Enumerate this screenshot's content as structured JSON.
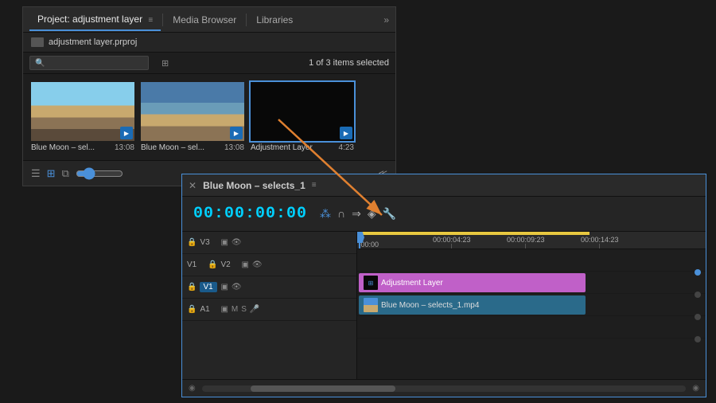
{
  "project_panel": {
    "tabs": [
      {
        "label": "Project: adjustment layer",
        "active": true
      },
      {
        "label": "Media Browser",
        "active": false
      },
      {
        "label": "Libraries",
        "active": false
      }
    ],
    "file_name": "adjustment layer.prproj",
    "search_placeholder": "",
    "status": "1 of 3 items selected",
    "thumbnails": [
      {
        "name": "Blue Moon – sel...",
        "duration": "13:08",
        "type": "beach1"
      },
      {
        "name": "Blue Moon – sel...",
        "duration": "13:08",
        "type": "beach2"
      },
      {
        "name": "Adjustment Layer",
        "duration": "4:23",
        "type": "dark",
        "selected": true
      }
    ]
  },
  "timeline": {
    "title": "Blue Moon – selects_1",
    "timecode": "00:00:00:00",
    "ruler": {
      "marks": [
        {
          "label": ":00:00",
          "pos": 2
        },
        {
          "label": "00:00:04:23",
          "pos": 95
        },
        {
          "label": "00:00:09:23",
          "pos": 188
        },
        {
          "label": "00:00:14:23",
          "pos": 281
        }
      ]
    },
    "tracks": [
      {
        "name": "V3",
        "type": "video"
      },
      {
        "name": "V2",
        "type": "video"
      },
      {
        "name": "V1",
        "type": "video",
        "active": true
      },
      {
        "name": "A1",
        "type": "audio"
      }
    ],
    "clips": [
      {
        "name": "Adjustment Layer",
        "type": "adjustment",
        "track": "V2"
      },
      {
        "name": "Blue Moon – selects_1.mp4",
        "type": "video",
        "track": "V1"
      }
    ]
  }
}
